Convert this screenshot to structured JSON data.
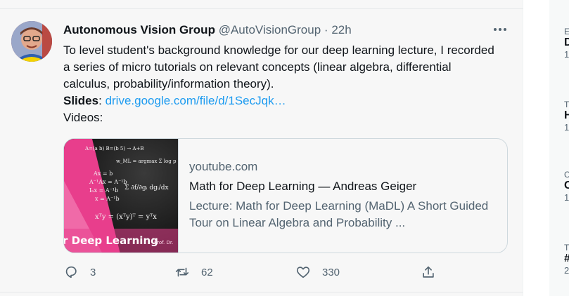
{
  "tweet": {
    "author_name": "Autonomous Vision Group",
    "handle": "@AutoVisionGroup",
    "separator": "·",
    "time": "22h",
    "text_line1": "To level student's background knowledge for our deep learning lecture, I recorded a series of micro tutorials on relevant concepts (linear algebra, differential calculus, probability/information theory).",
    "slides_label": "Slides",
    "slides_colon": ":",
    "slides_link": "drive.google.com/file/d/1SecJqk…",
    "videos_label": "Videos:"
  },
  "card": {
    "domain": "youtube.com",
    "title": "Math for Deep Learning — Andreas Geiger",
    "description": "Lecture: Math for Deep Learning (MaDL) A Short Guided Tour on Linear Algebra and Probability ...",
    "thumb_caption": "r Deep Learning",
    "thumb_author": "Prof. Dr.",
    "thumb_accent": "#e83e8c"
  },
  "actions": {
    "reply_count": "3",
    "retweet_count": "62",
    "like_count": "330",
    "reply_icon": "reply-icon",
    "retweet_icon": "retweet-icon",
    "like_icon": "heart-icon",
    "share_icon": "share-icon"
  },
  "sidebar": {
    "items": [
      {
        "cat": "E",
        "head": "D",
        "meta": "1"
      },
      {
        "cat": "T",
        "head": "H",
        "meta": "1"
      },
      {
        "cat": "C",
        "head": "C",
        "meta": "1"
      },
      {
        "cat": "T",
        "head": "#",
        "meta": "2"
      }
    ]
  },
  "colors": {
    "link": "#1d9bf0",
    "muted": "#536471",
    "text": "#0f1419",
    "background": "#f7f7f7"
  }
}
